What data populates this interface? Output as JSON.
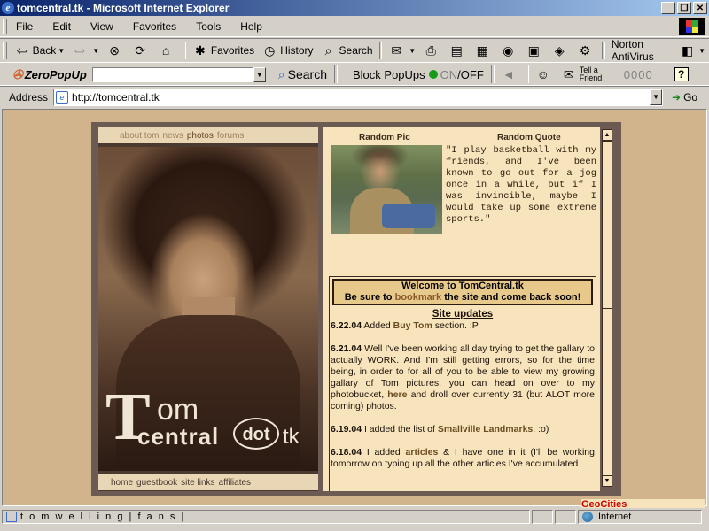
{
  "window": {
    "title": "tomcentral.tk - Microsoft Internet Explorer",
    "min_label": "_",
    "max_label": "❐",
    "close_label": "✕"
  },
  "menu": [
    "File",
    "Edit",
    "View",
    "Favorites",
    "Tools",
    "Help"
  ],
  "toolbar": {
    "back_label": "Back",
    "favorites_label": "Favorites",
    "history_label": "History",
    "search_label": "Search",
    "norton_label": "Norton AntiVirus"
  },
  "zeropopup": {
    "brand": "ZeroPopUp",
    "search_label": "Search",
    "block_label": "Block PopUps",
    "on_label": "ON",
    "off_label": "/OFF",
    "tellfriend_label": "Tell a Friend",
    "counter": "0000",
    "help_label": "?"
  },
  "address": {
    "label": "Address",
    "url": "http://tomcentral.tk",
    "go_label": "Go"
  },
  "site": {
    "topnav": [
      "about tom",
      "news",
      "photos",
      "forums"
    ],
    "botnav": [
      "home",
      "guestbook",
      "site links",
      "affiliates"
    ],
    "logo": {
      "T": "T",
      "om": "om",
      "central": "central",
      "dot": "dot",
      "tk": "tk"
    },
    "random_pic_heading": "Random Pic",
    "random_quote_heading": "Random Quote",
    "quote": "\"I play basketball with my friends, and I've been known to go out for a jog once in a while, but if I was invincible, maybe I would take up some extreme sports.\"",
    "welcome_line1": "Welcome to TomCentral.tk",
    "welcome_line2_pre": "Be sure to ",
    "welcome_link": "bookmark",
    "welcome_line2_post": " the site and come back soon!",
    "updates_heading": "Site updates",
    "updates": [
      {
        "date": "6.22.04",
        "pre": " Added ",
        "link": "Buy Tom",
        "post": " section. :P"
      },
      {
        "date": "6.21.04",
        "pre": " Well I've been working all day trying to get the gallary to actually WORK. And I'm still getting errors, so for the time being, in order to for all of you to be able to view my growing gallary of Tom pictures, you can head on over to my photobucket, ",
        "link": "here",
        "post": " and droll over currently 31 (but ALOT more coming) photos."
      },
      {
        "date": "6.19.04",
        "pre": " I added the list of ",
        "link": "Smallville Landmarks",
        "post": ". :o)"
      },
      {
        "date": "6.18.04",
        "pre": " I added ",
        "link": "articles",
        "post": " & I have one in it (I'll be working tomorrow on typing up all the other articles I've accumulated"
      }
    ]
  },
  "status": {
    "text": "t o m w e l l i n g | f a n s |",
    "zone": "Internet",
    "geocities": "GeoCities"
  }
}
